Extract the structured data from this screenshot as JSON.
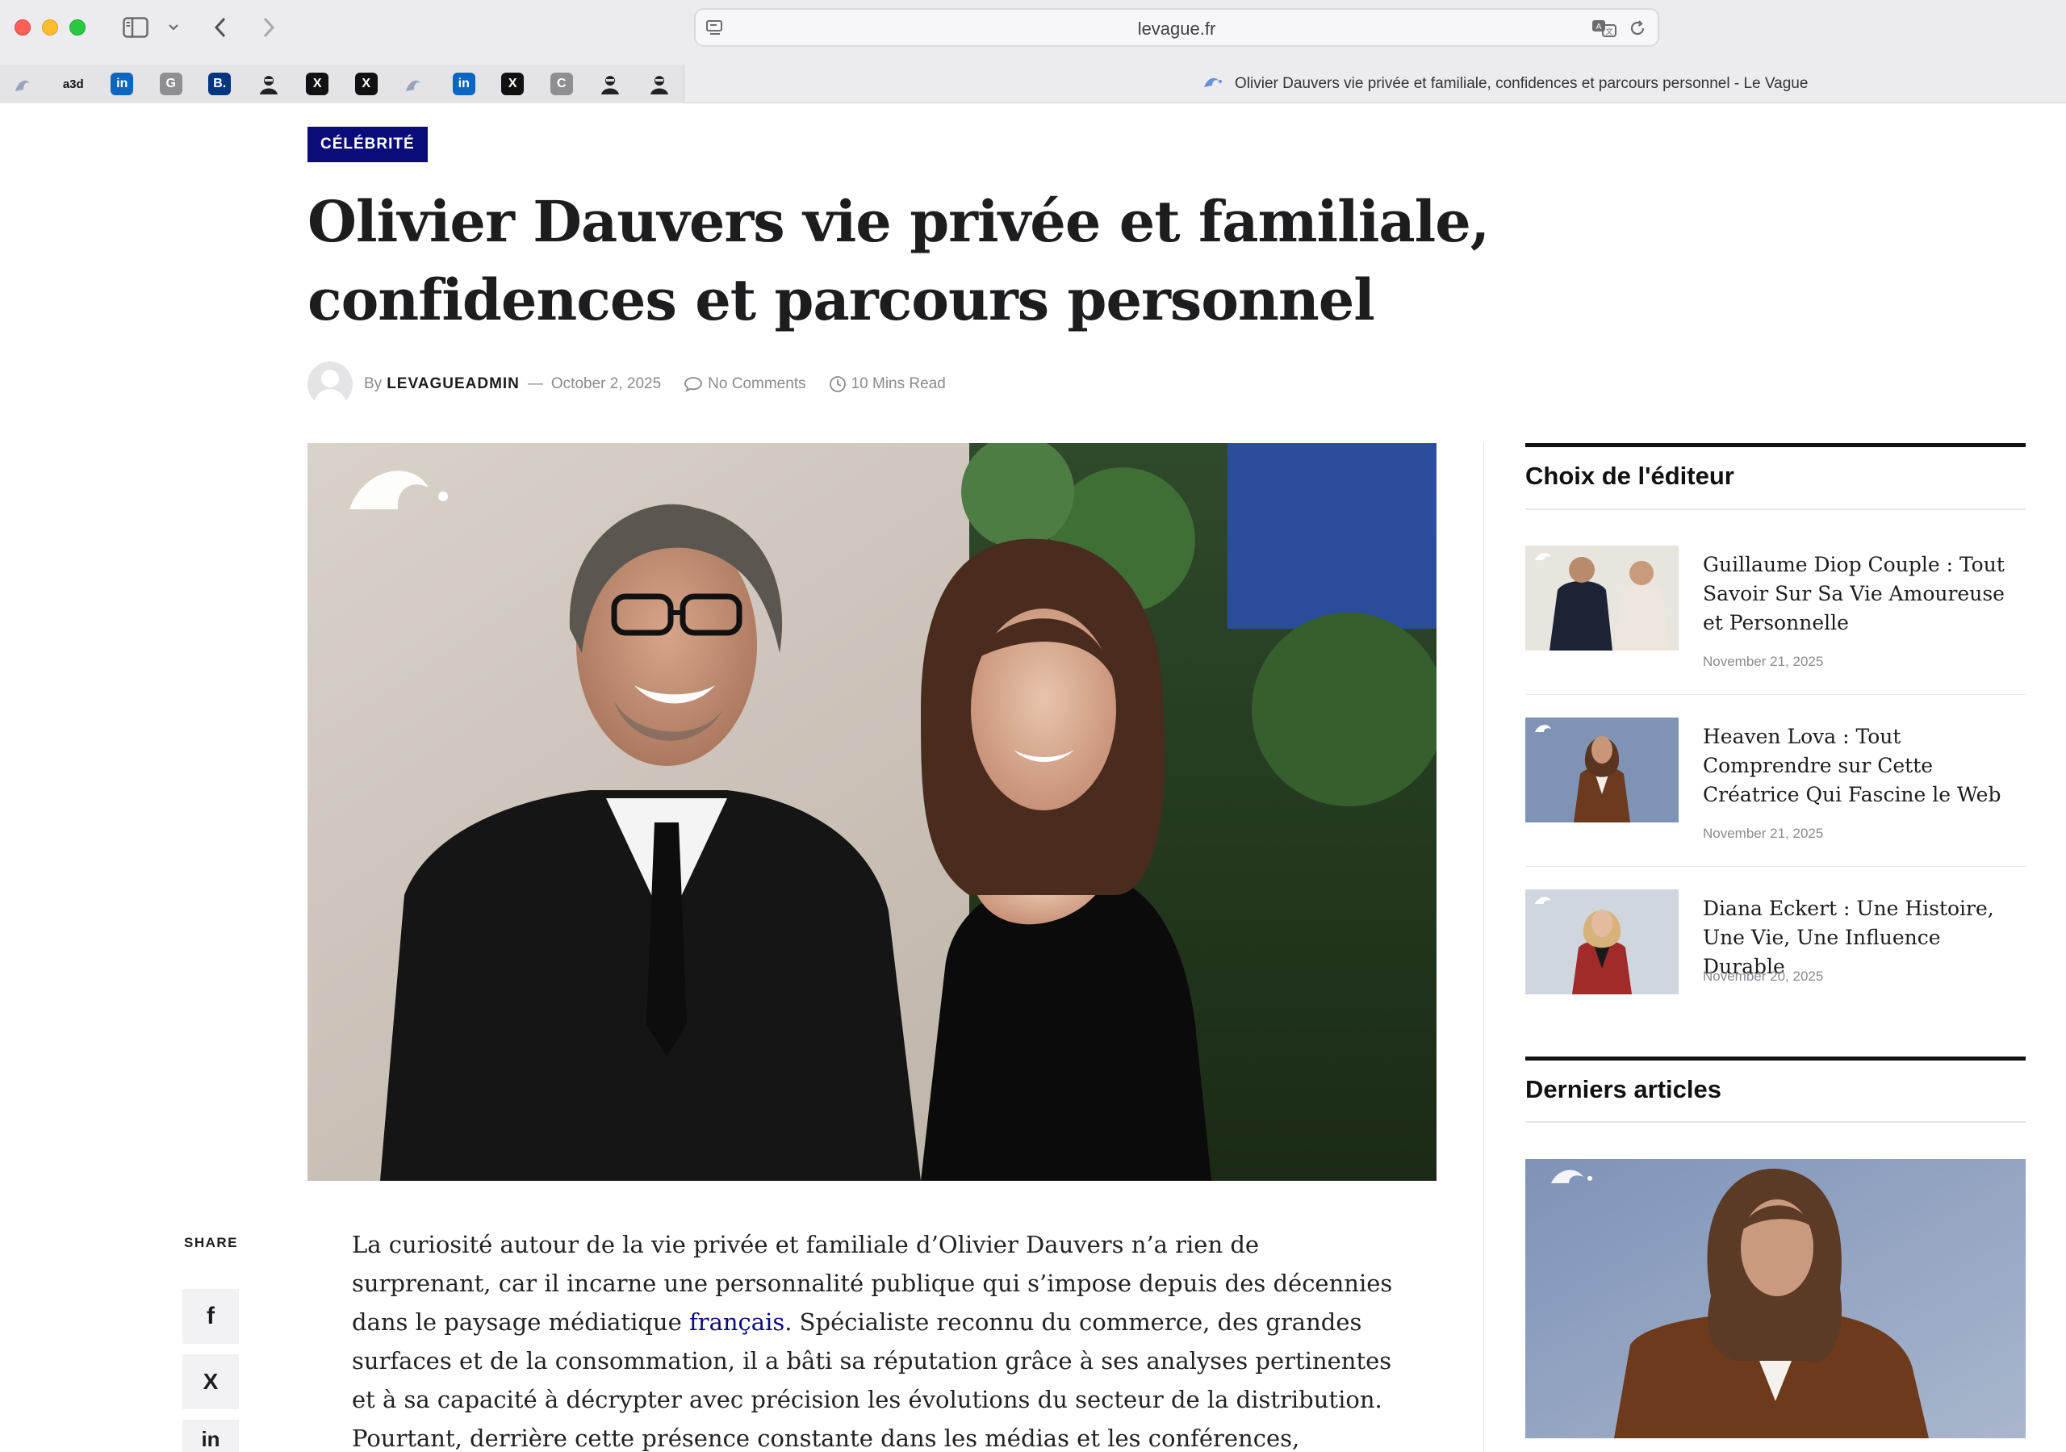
{
  "browser": {
    "url": "levague.fr",
    "tab_title": "Olivier Dauvers vie privée et familiale, confidences et parcours personnel - Le Vague",
    "favorites": [
      {
        "icon": "wave-favicon",
        "glyph": "",
        "bg": "#e4e4e8",
        "fg": "#888"
      },
      {
        "icon": "a3d-favicon",
        "glyph": "a3d",
        "bg": "#e4e4e8",
        "fg": "#111"
      },
      {
        "icon": "linkedin-favicon",
        "glyph": "in",
        "bg": "#0a66c2",
        "fg": "#ffffff"
      },
      {
        "icon": "g-favicon",
        "glyph": "G",
        "bg": "#8e8e93",
        "fg": "#ffffff"
      },
      {
        "icon": "booking-favicon",
        "glyph": "B.",
        "bg": "#003580",
        "fg": "#ffffff"
      },
      {
        "icon": "profile-favicon",
        "glyph": "",
        "bg": "#e4e4e8",
        "fg": "#111"
      },
      {
        "icon": "x-favicon",
        "glyph": "X",
        "bg": "#111111",
        "fg": "#ffffff"
      },
      {
        "icon": "x-favicon",
        "glyph": "X",
        "bg": "#111111",
        "fg": "#ffffff"
      },
      {
        "icon": "wave-favicon",
        "glyph": "",
        "bg": "#e4e4e8",
        "fg": "#888"
      },
      {
        "icon": "linkedin-favicon",
        "glyph": "in",
        "bg": "#0a66c2",
        "fg": "#ffffff"
      },
      {
        "icon": "x-favicon",
        "glyph": "X",
        "bg": "#111111",
        "fg": "#ffffff"
      },
      {
        "icon": "c-favicon",
        "glyph": "C",
        "bg": "#8e8e93",
        "fg": "#ffffff"
      },
      {
        "icon": "profile-favicon",
        "glyph": "",
        "bg": "#e4e4e8",
        "fg": "#111"
      },
      {
        "icon": "profile-favicon",
        "glyph": "",
        "bg": "#e4e4e8",
        "fg": "#111"
      }
    ]
  },
  "article": {
    "category": "CÉLÉBRITÉ",
    "title": "Olivier Dauvers vie privée et familiale, confidences et parcours personnel",
    "by": "By",
    "author": "LEVAGUEADMIN",
    "dash": "—",
    "date": "October 2, 2025",
    "comments": "No Comments",
    "read_time": "10 Mins Read",
    "body_before_link": "La curiosité autour de la vie privée et familiale d’Olivier Dauvers n’a rien de surprenant, car il incarne une personnalité publique qui s’impose depuis des décennies dans le paysage médiatique ",
    "body_link": "français",
    "body_after_link": ". Spécialiste reconnu du commerce, des grandes surfaces et de la consommation, il a bâti sa réputation grâce à ses analyses pertinentes et à sa capacité à décrypter avec précision les évolutions du secteur de la distribution. Pourtant, derrière cette présence constante dans les médias et les conférences, l’homme a toujours cultivé une forme de discrétion qui attise l’intérêt."
  },
  "share": {
    "label": "SHARE",
    "facebook": "f",
    "x": "X",
    "linkedin": "in"
  },
  "sidebar": {
    "editors_choice_title": "Choix de l'éditeur",
    "picks": [
      {
        "title": "Guillaume Diop Couple : Tout Savoir Sur Sa Vie Amoureuse et Personnelle",
        "date": "November 21, 2025"
      },
      {
        "title": "Heaven Lova : Tout Comprendre sur Cette Créatrice Qui Fascine le Web",
        "date": "November 21, 2025"
      },
      {
        "title": "Diana Eckert : Une Histoire, Une Vie, Une Influence Durable",
        "date": "November 20, 2025"
      }
    ],
    "latest_title": "Derniers articles"
  },
  "colors": {
    "accent": "#0b0b7a",
    "text": "#1d1d1f",
    "muted": "#8a8a90"
  }
}
